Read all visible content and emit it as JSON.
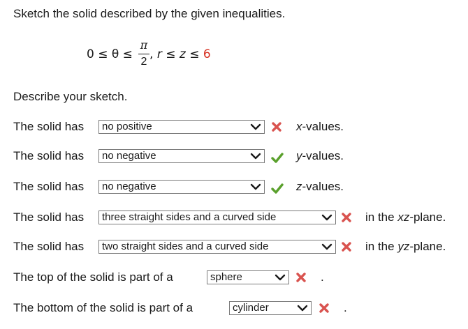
{
  "title": "Sketch the solid described by the given inequalities.",
  "formula": {
    "lhs": "0 ≤ θ ≤ ",
    "frac_num": "π",
    "frac_den": "2",
    "rhs_comma": ",",
    "rhs_r": "r",
    "rhs_le": " ≤ ",
    "rhs_z": "z",
    "rhs_le2": " ≤ ",
    "rhs_val": "6",
    "red_color": "#d62e1f"
  },
  "describe": "Describe your sketch.",
  "rows": [
    {
      "prefix": "The solid has",
      "value": "no positive",
      "status": "incorrect",
      "suffix_var": "x",
      "suffix": "-values."
    },
    {
      "prefix": "The solid has",
      "value": "no negative",
      "status": "correct",
      "suffix_var": "y",
      "suffix": "-values."
    },
    {
      "prefix": "The solid has",
      "value": "no negative",
      "status": "correct",
      "suffix_var": "z",
      "suffix": "-values."
    },
    {
      "prefix": "The solid has",
      "value": "three straight sides and a curved side",
      "status": "incorrect",
      "suffix_pre": "in the ",
      "suffix_var": "xz",
      "suffix": "-plane."
    },
    {
      "prefix": "The solid has",
      "value": "two straight sides and a curved side",
      "status": "incorrect",
      "suffix_pre": "in the ",
      "suffix_var": "yz",
      "suffix": "-plane."
    },
    {
      "prefix": "The top of the solid is part of a",
      "value": "sphere",
      "status": "incorrect",
      "suffix": "."
    },
    {
      "prefix": "The bottom of the solid is part of a",
      "value": "cylinder",
      "status": "incorrect",
      "suffix": "."
    }
  ],
  "icons": {
    "dropdown": "chevron-down-icon",
    "correct": "check-icon",
    "incorrect": "x-icon"
  },
  "colors": {
    "correct": "#5aa02c",
    "incorrect": "#d9534f"
  }
}
